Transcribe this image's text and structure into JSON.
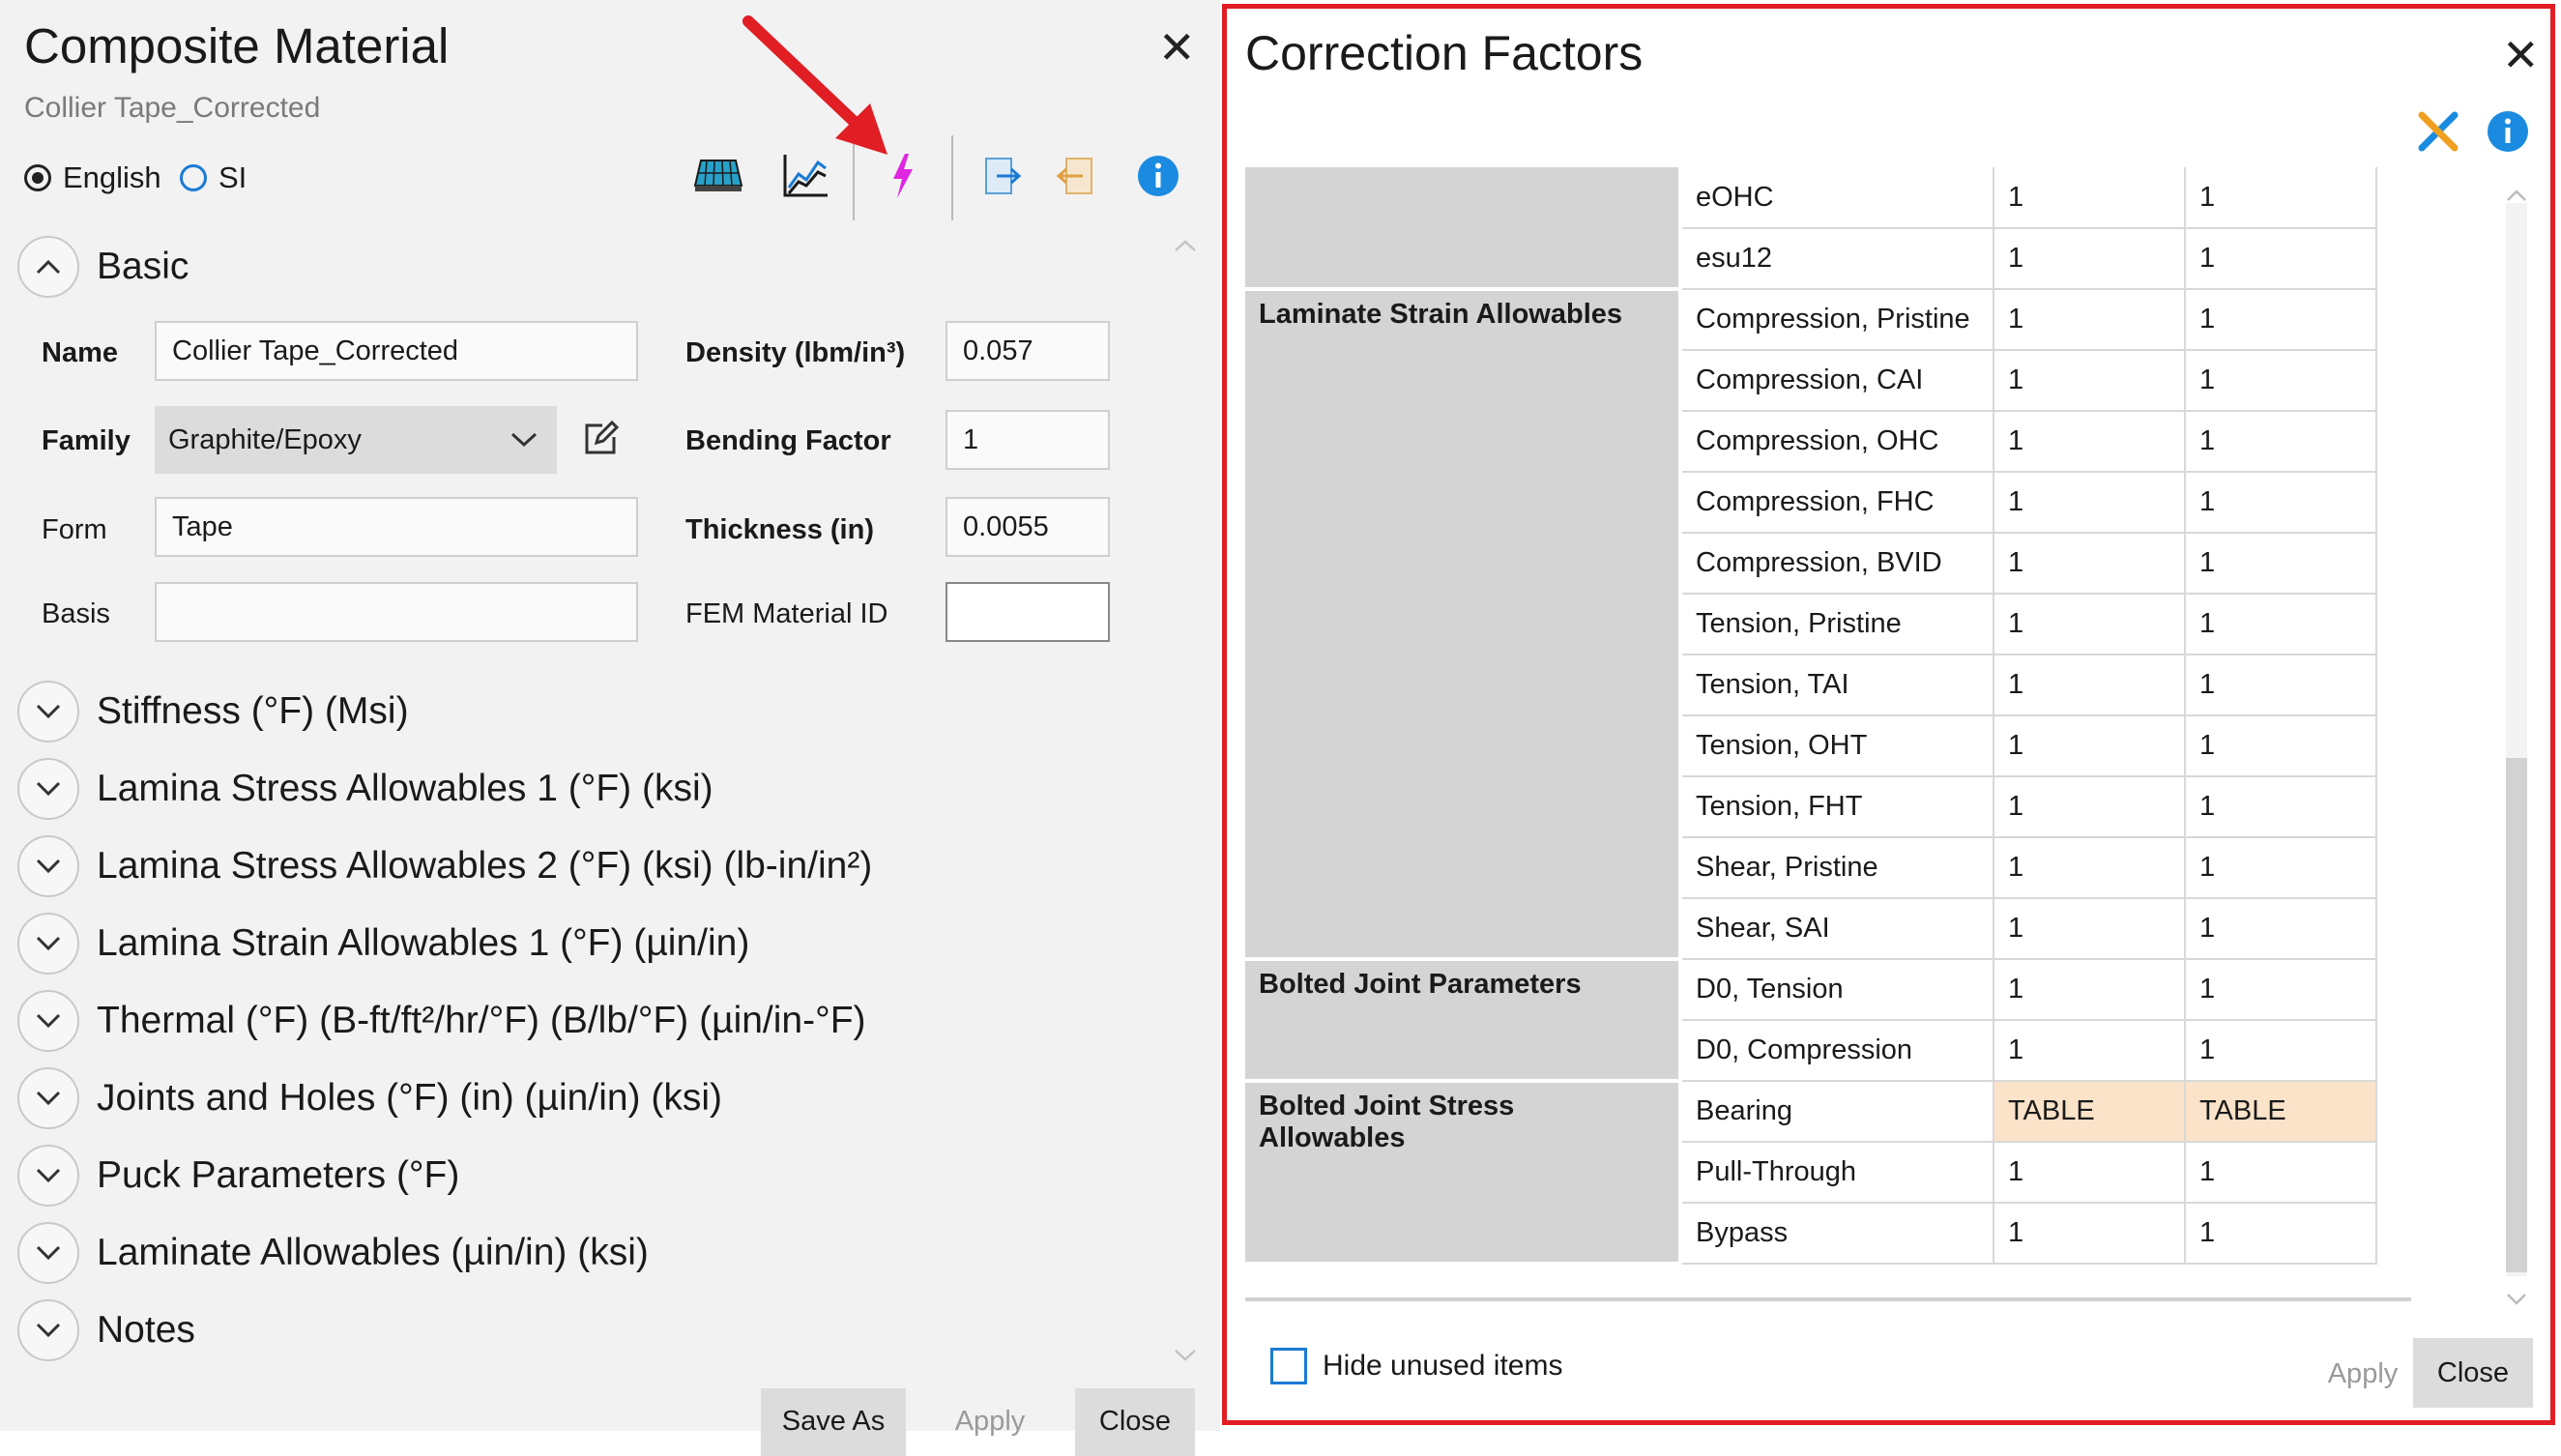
{
  "composite_dialog": {
    "title": "Composite Material",
    "subtitle": "Collier Tape_Corrected",
    "units": {
      "english": "English",
      "si": "SI",
      "selected": "English"
    },
    "toolbar": {
      "icons": [
        "laminate-grid-icon",
        "chart-icon",
        "lightning-icon",
        "export-icon",
        "import-icon",
        "info-icon"
      ]
    },
    "sections": {
      "basic": "Basic",
      "collapsed": [
        "Stiffness (°F) (Msi)",
        "Lamina Stress Allowables 1 (°F) (ksi)",
        "Lamina Stress Allowables 2 (°F) (ksi) (lb-in/in²)",
        "Lamina Strain Allowables 1 (°F) (µin/in)",
        "Thermal (°F) (B-ft/ft²/hr/°F) (B/lb/°F) (µin/in-°F)",
        "Joints and Holes (°F) (in) (µin/in) (ksi)",
        "Puck Parameters (°F)",
        "Laminate Allowables (µin/in) (ksi)",
        "Notes"
      ]
    },
    "fields": {
      "name_label": "Name",
      "name_value": "Collier Tape_Corrected",
      "family_label": "Family",
      "family_value": "Graphite/Epoxy",
      "form_label": "Form",
      "form_value": "Tape",
      "basis_label": "Basis",
      "basis_value": "",
      "density_label": "Density (lbm/in³)",
      "density_value": "0.057",
      "bending_label": "Bending Factor",
      "bending_value": "1",
      "thickness_label": "Thickness (in)",
      "thickness_value": "0.0055",
      "fem_label": "FEM Material ID",
      "fem_value": ""
    },
    "buttons": {
      "save_as": "Save As",
      "apply": "Apply",
      "close": "Close"
    }
  },
  "correction_dialog": {
    "title": "Correction Factors",
    "groups": [
      {
        "name": "",
        "rows": [
          {
            "item": "eOHC",
            "v1": "1",
            "v2": "1"
          },
          {
            "item": "esu12",
            "v1": "1",
            "v2": "1"
          }
        ]
      },
      {
        "name": "Laminate Strain Allowables",
        "rows": [
          {
            "item": "Compression, Pristine",
            "v1": "1",
            "v2": "1"
          },
          {
            "item": "Compression, CAI",
            "v1": "1",
            "v2": "1"
          },
          {
            "item": "Compression, OHC",
            "v1": "1",
            "v2": "1"
          },
          {
            "item": "Compression, FHC",
            "v1": "1",
            "v2": "1"
          },
          {
            "item": "Compression, BVID",
            "v1": "1",
            "v2": "1"
          },
          {
            "item": "Tension, Pristine",
            "v1": "1",
            "v2": "1"
          },
          {
            "item": "Tension, TAI",
            "v1": "1",
            "v2": "1"
          },
          {
            "item": "Tension, OHT",
            "v1": "1",
            "v2": "1"
          },
          {
            "item": "Tension, FHT",
            "v1": "1",
            "v2": "1"
          },
          {
            "item": "Shear, Pristine",
            "v1": "1",
            "v2": "1"
          },
          {
            "item": "Shear, SAI",
            "v1": "1",
            "v2": "1"
          }
        ]
      },
      {
        "name": "Bolted Joint Parameters",
        "rows": [
          {
            "item": "D0, Tension",
            "v1": "1",
            "v2": "1"
          },
          {
            "item": "D0, Compression",
            "v1": "1",
            "v2": "1"
          }
        ]
      },
      {
        "name": "Bolted Joint Stress Allowables",
        "rows": [
          {
            "item": "Bearing",
            "v1": "TABLE",
            "v2": "TABLE",
            "highlight": true
          },
          {
            "item": "Pull-Through",
            "v1": "1",
            "v2": "1"
          },
          {
            "item": "Bypass",
            "v1": "1",
            "v2": "1"
          }
        ]
      }
    ],
    "hide_unused": "Hide unused items",
    "buttons": {
      "apply": "Apply",
      "close": "Close"
    }
  },
  "colors": {
    "highlight_frame": "#e01e24",
    "arrow": "#e01e24",
    "table_cell_highlight": "#fbe3c9",
    "accent": "#1a7ad4"
  }
}
